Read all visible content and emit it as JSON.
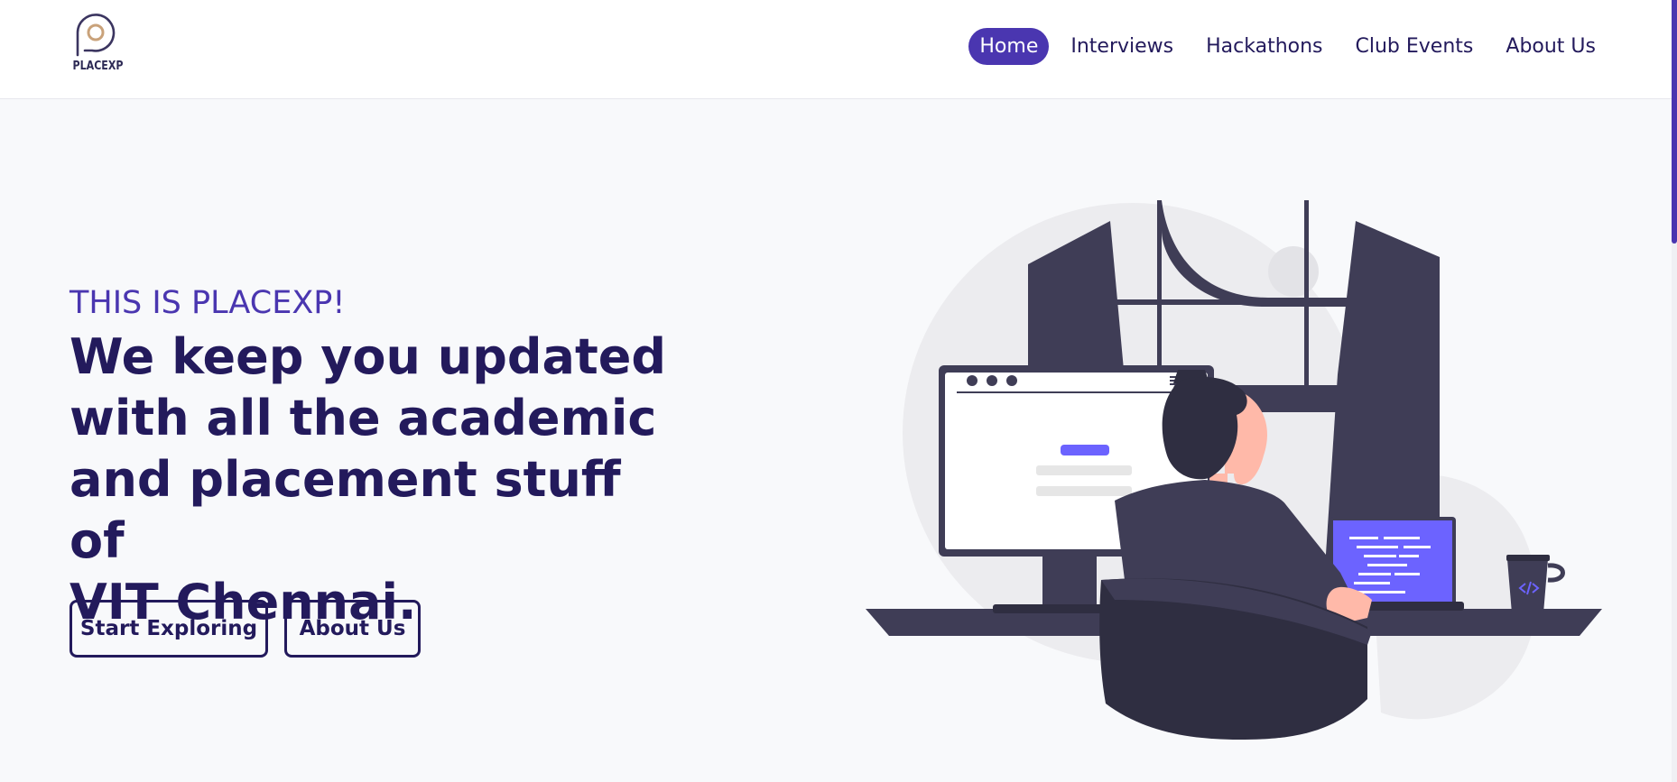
{
  "brand": {
    "logo_text": "PLACEXP"
  },
  "nav": {
    "items": [
      {
        "label": "Home"
      },
      {
        "label": "Interviews"
      },
      {
        "label": "Hackathons"
      },
      {
        "label": "Club Events"
      },
      {
        "label": "About Us"
      }
    ],
    "active_index": 0
  },
  "hero": {
    "eyebrow": "THIS IS PLACEXP!",
    "headline": "We keep you updated\nwith all the academic\nand placement stuff of\nVIT Chennai.",
    "buttons": {
      "start": "Start Exploring",
      "about": "About Us"
    }
  },
  "colors": {
    "accent": "#4a36b0",
    "text_dark": "#231a5c",
    "background": "#f8f9fb",
    "illustration_dark": "#3f3d56",
    "illustration_purple": "#6c63ff"
  },
  "icons": {
    "logo": "location-pin-icon",
    "laptop_code": "code-brackets-icon"
  }
}
